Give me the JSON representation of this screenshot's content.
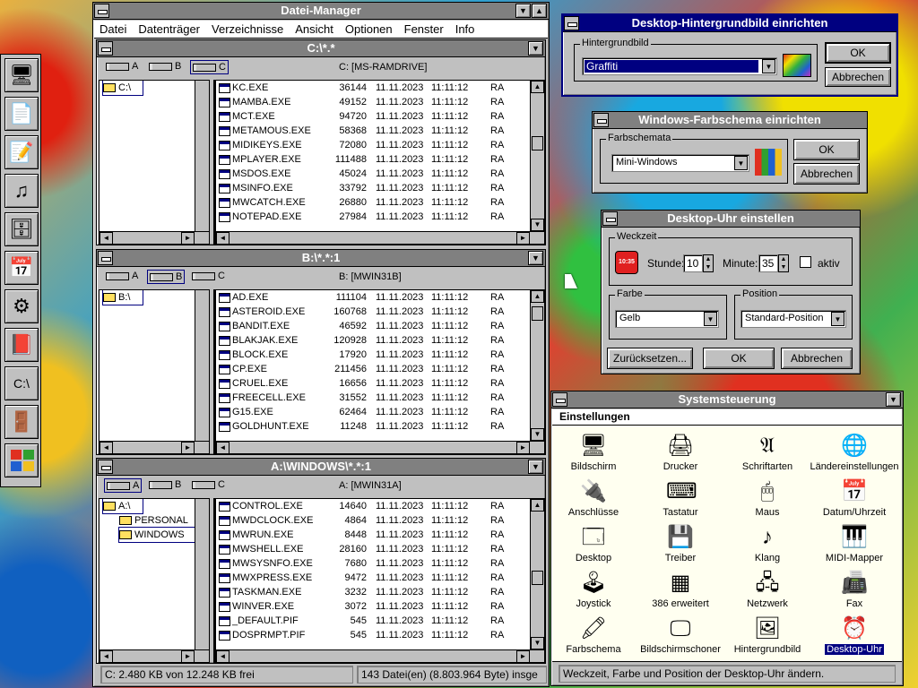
{
  "file_manager": {
    "title": "Datei-Manager",
    "menu": [
      "Datei",
      "Datenträger",
      "Verzeichnisse",
      "Ansicht",
      "Optionen",
      "Fenster",
      "Info"
    ],
    "status_left": "C: 2.480 KB von 12.248 KB frei",
    "status_right": "143 Datei(en) (8.803.964 Byte) insge"
  },
  "drive_labels": [
    "A",
    "B",
    "C"
  ],
  "panes": [
    {
      "title": "C:\\*.*",
      "volume": "C: [MS-RAMDRIVE]",
      "tree": [
        "C:\\"
      ],
      "files": [
        [
          "KC.EXE",
          "36144",
          "11.11.2023",
          "11:11:12",
          "RA"
        ],
        [
          "MAMBA.EXE",
          "49152",
          "11.11.2023",
          "11:11:12",
          "RA"
        ],
        [
          "MCT.EXE",
          "94720",
          "11.11.2023",
          "11:11:12",
          "RA"
        ],
        [
          "METAMOUS.EXE",
          "58368",
          "11.11.2023",
          "11:11:12",
          "RA"
        ],
        [
          "MIDIKEYS.EXE",
          "72080",
          "11.11.2023",
          "11:11:12",
          "RA"
        ],
        [
          "MPLAYER.EXE",
          "111488",
          "11.11.2023",
          "11:11:12",
          "RA"
        ],
        [
          "MSDOS.EXE",
          "45024",
          "11.11.2023",
          "11:11:12",
          "RA"
        ],
        [
          "MSINFO.EXE",
          "33792",
          "11.11.2023",
          "11:11:12",
          "RA"
        ],
        [
          "MWCATCH.EXE",
          "26880",
          "11.11.2023",
          "11:11:12",
          "RA"
        ],
        [
          "NOTEPAD.EXE",
          "27984",
          "11.11.2023",
          "11:11:12",
          "RA"
        ]
      ]
    },
    {
      "title": "B:\\*.*:1",
      "volume": "B: [MWIN31B]",
      "tree": [
        "B:\\"
      ],
      "files": [
        [
          "AD.EXE",
          "111104",
          "11.11.2023",
          "11:11:12",
          "RA"
        ],
        [
          "ASTEROID.EXE",
          "160768",
          "11.11.2023",
          "11:11:12",
          "RA"
        ],
        [
          "BANDIT.EXE",
          "46592",
          "11.11.2023",
          "11:11:12",
          "RA"
        ],
        [
          "BLAKJAK.EXE",
          "120928",
          "11.11.2023",
          "11:11:12",
          "RA"
        ],
        [
          "BLOCK.EXE",
          "17920",
          "11.11.2023",
          "11:11:12",
          "RA"
        ],
        [
          "CP.EXE",
          "211456",
          "11.11.2023",
          "11:11:12",
          "RA"
        ],
        [
          "CRUEL.EXE",
          "16656",
          "11.11.2023",
          "11:11:12",
          "RA"
        ],
        [
          "FREECELL.EXE",
          "31552",
          "11.11.2023",
          "11:11:12",
          "RA"
        ],
        [
          "G15.EXE",
          "62464",
          "11.11.2023",
          "11:11:12",
          "RA"
        ],
        [
          "GOLDHUNT.EXE",
          "11248",
          "11.11.2023",
          "11:11:12",
          "RA"
        ]
      ]
    },
    {
      "title": "A:\\WINDOWS\\*.*:1",
      "volume": "A: [MWIN31A]",
      "tree": [
        "A:\\",
        "PERSONAL",
        "WINDOWS"
      ],
      "files": [
        [
          "CONTROL.EXE",
          "14640",
          "11.11.2023",
          "11:11:12",
          "RA"
        ],
        [
          "MWDCLOCK.EXE",
          "4864",
          "11.11.2023",
          "11:11:12",
          "RA"
        ],
        [
          "MWRUN.EXE",
          "8448",
          "11.11.2023",
          "11:11:12",
          "RA"
        ],
        [
          "MWSHELL.EXE",
          "28160",
          "11.11.2023",
          "11:11:12",
          "RA"
        ],
        [
          "MWSYSNFO.EXE",
          "7680",
          "11.11.2023",
          "11:11:12",
          "RA"
        ],
        [
          "MWXPRESS.EXE",
          "9472",
          "11.11.2023",
          "11:11:12",
          "RA"
        ],
        [
          "TASKMAN.EXE",
          "3232",
          "11.11.2023",
          "11:11:12",
          "RA"
        ],
        [
          "WINVER.EXE",
          "3072",
          "11.11.2023",
          "11:11:12",
          "RA"
        ],
        [
          "_DEFAULT.PIF",
          "545",
          "11.11.2023",
          "11:11:12",
          "RA"
        ],
        [
          "DOSPRMPT.PIF",
          "545",
          "11.11.2023",
          "11:11:12",
          "RA"
        ]
      ]
    }
  ],
  "wallpaper_dlg": {
    "title": "Desktop-Hintergrundbild einrichten",
    "group": "Hintergrundbild",
    "value": "Graffiti",
    "ok": "OK",
    "cancel": "Abbrechen"
  },
  "scheme_dlg": {
    "title": "Windows-Farbschema einrichten",
    "group": "Farbschemata",
    "value": "Mini-Windows",
    "ok": "OK",
    "cancel": "Abbrechen"
  },
  "clock_dlg": {
    "title": "Desktop-Uhr einstellen",
    "alarm_group": "Weckzeit",
    "hour_label": "Stunde:",
    "hour": "10",
    "minute_label": "Minute:",
    "minute": "35",
    "active_label": "aktiv",
    "clock_text": "10:35",
    "color_group": "Farbe",
    "color_value": "Gelb",
    "pos_group": "Position",
    "pos_value": "Standard-Position",
    "reset": "Zurücksetzen...",
    "ok": "OK",
    "cancel": "Abbrechen"
  },
  "control_panel": {
    "title": "Systemsteuerung",
    "menu": "Einstellungen",
    "items": [
      {
        "label": "Bildschirm",
        "icon": "monitor-icon"
      },
      {
        "label": "Drucker",
        "icon": "printer-icon"
      },
      {
        "label": "Schriftarten",
        "icon": "fonts-icon"
      },
      {
        "label": "Ländereinstellungen",
        "icon": "globe-icon"
      },
      {
        "label": "Anschlüsse",
        "icon": "plug-icon"
      },
      {
        "label": "Tastatur",
        "icon": "keyboard-icon"
      },
      {
        "label": "Maus",
        "icon": "mouse-icon"
      },
      {
        "label": "Datum/Uhrzeit",
        "icon": "calendar-clock-icon"
      },
      {
        "label": "Desktop",
        "icon": "desktop-icon"
      },
      {
        "label": "Treiber",
        "icon": "driver-icon"
      },
      {
        "label": "Klang",
        "icon": "sound-icon"
      },
      {
        "label": "MIDI-Mapper",
        "icon": "midi-icon"
      },
      {
        "label": "Joystick",
        "icon": "joystick-icon"
      },
      {
        "label": "386 erweitert",
        "icon": "chip-icon"
      },
      {
        "label": "Netzwerk",
        "icon": "network-icon"
      },
      {
        "label": "Fax",
        "icon": "fax-icon"
      },
      {
        "label": "Farbschema",
        "icon": "crayons-icon"
      },
      {
        "label": "Bildschirmschoner",
        "icon": "screensaver-icon"
      },
      {
        "label": "Hintergrundbild",
        "icon": "wallpaper-icon"
      },
      {
        "label": "Desktop-Uhr",
        "icon": "alarm-clock-icon"
      }
    ],
    "status": "Weckzeit, Farbe und Position der Desktop-Uhr ändern."
  },
  "toolbar_icons": [
    "setup-icon",
    "copy-icon",
    "notes-icon",
    "music-icon",
    "cabinet-icon",
    "calendar-icon",
    "settings-icon",
    "help-book-icon",
    "dos-prompt-icon",
    "exit-icon",
    "windows-logo-icon"
  ]
}
